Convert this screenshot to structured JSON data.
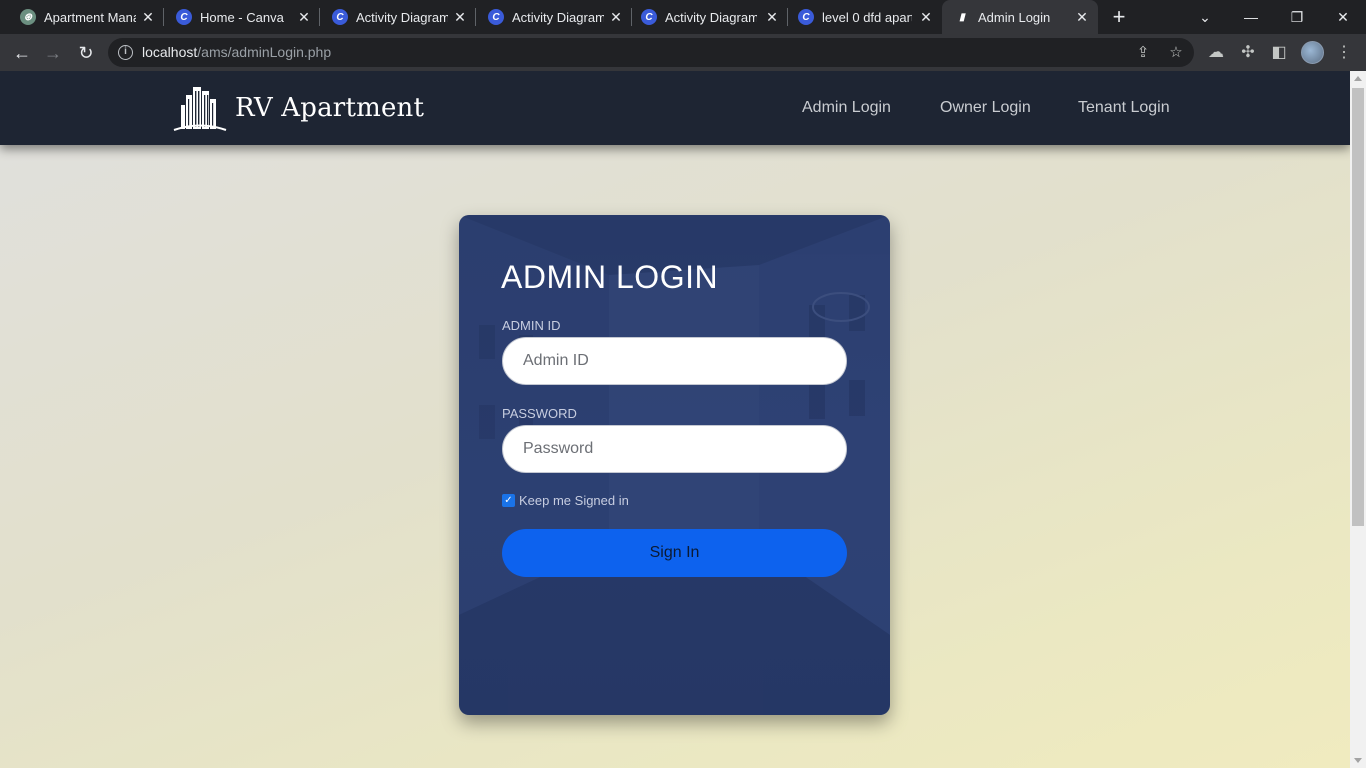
{
  "browser": {
    "tabs": [
      {
        "title": "Apartment Mana",
        "icon": "chatgpt-icon"
      },
      {
        "title": "Home - Canva",
        "icon": "canva-icon"
      },
      {
        "title": "Activity Diagram",
        "icon": "canva-icon"
      },
      {
        "title": "Activity Diagram",
        "icon": "canva-icon"
      },
      {
        "title": "Activity Diagram",
        "icon": "canva-icon"
      },
      {
        "title": "level 0 dfd apartr",
        "icon": "canva-icon"
      },
      {
        "title": "Admin Login",
        "icon": "building-icon",
        "active": true
      }
    ],
    "url_host": "localhost",
    "url_path": "/ams/adminLogin.php"
  },
  "site": {
    "brand": "RV Apartment",
    "nav": [
      "Admin Login",
      "Owner Login",
      "Tenant Login"
    ]
  },
  "login": {
    "title": "ADMIN LOGIN",
    "id_label": "ADMIN ID",
    "id_placeholder": "Admin ID",
    "password_label": "PASSWORD",
    "password_placeholder": "Password",
    "remember_label": "Keep me Signed in",
    "remember_checked": true,
    "submit": "Sign In"
  },
  "colors": {
    "nav_bg": "#1e2533",
    "card_bg": "#2c3f72",
    "button": "#0d62ee"
  }
}
